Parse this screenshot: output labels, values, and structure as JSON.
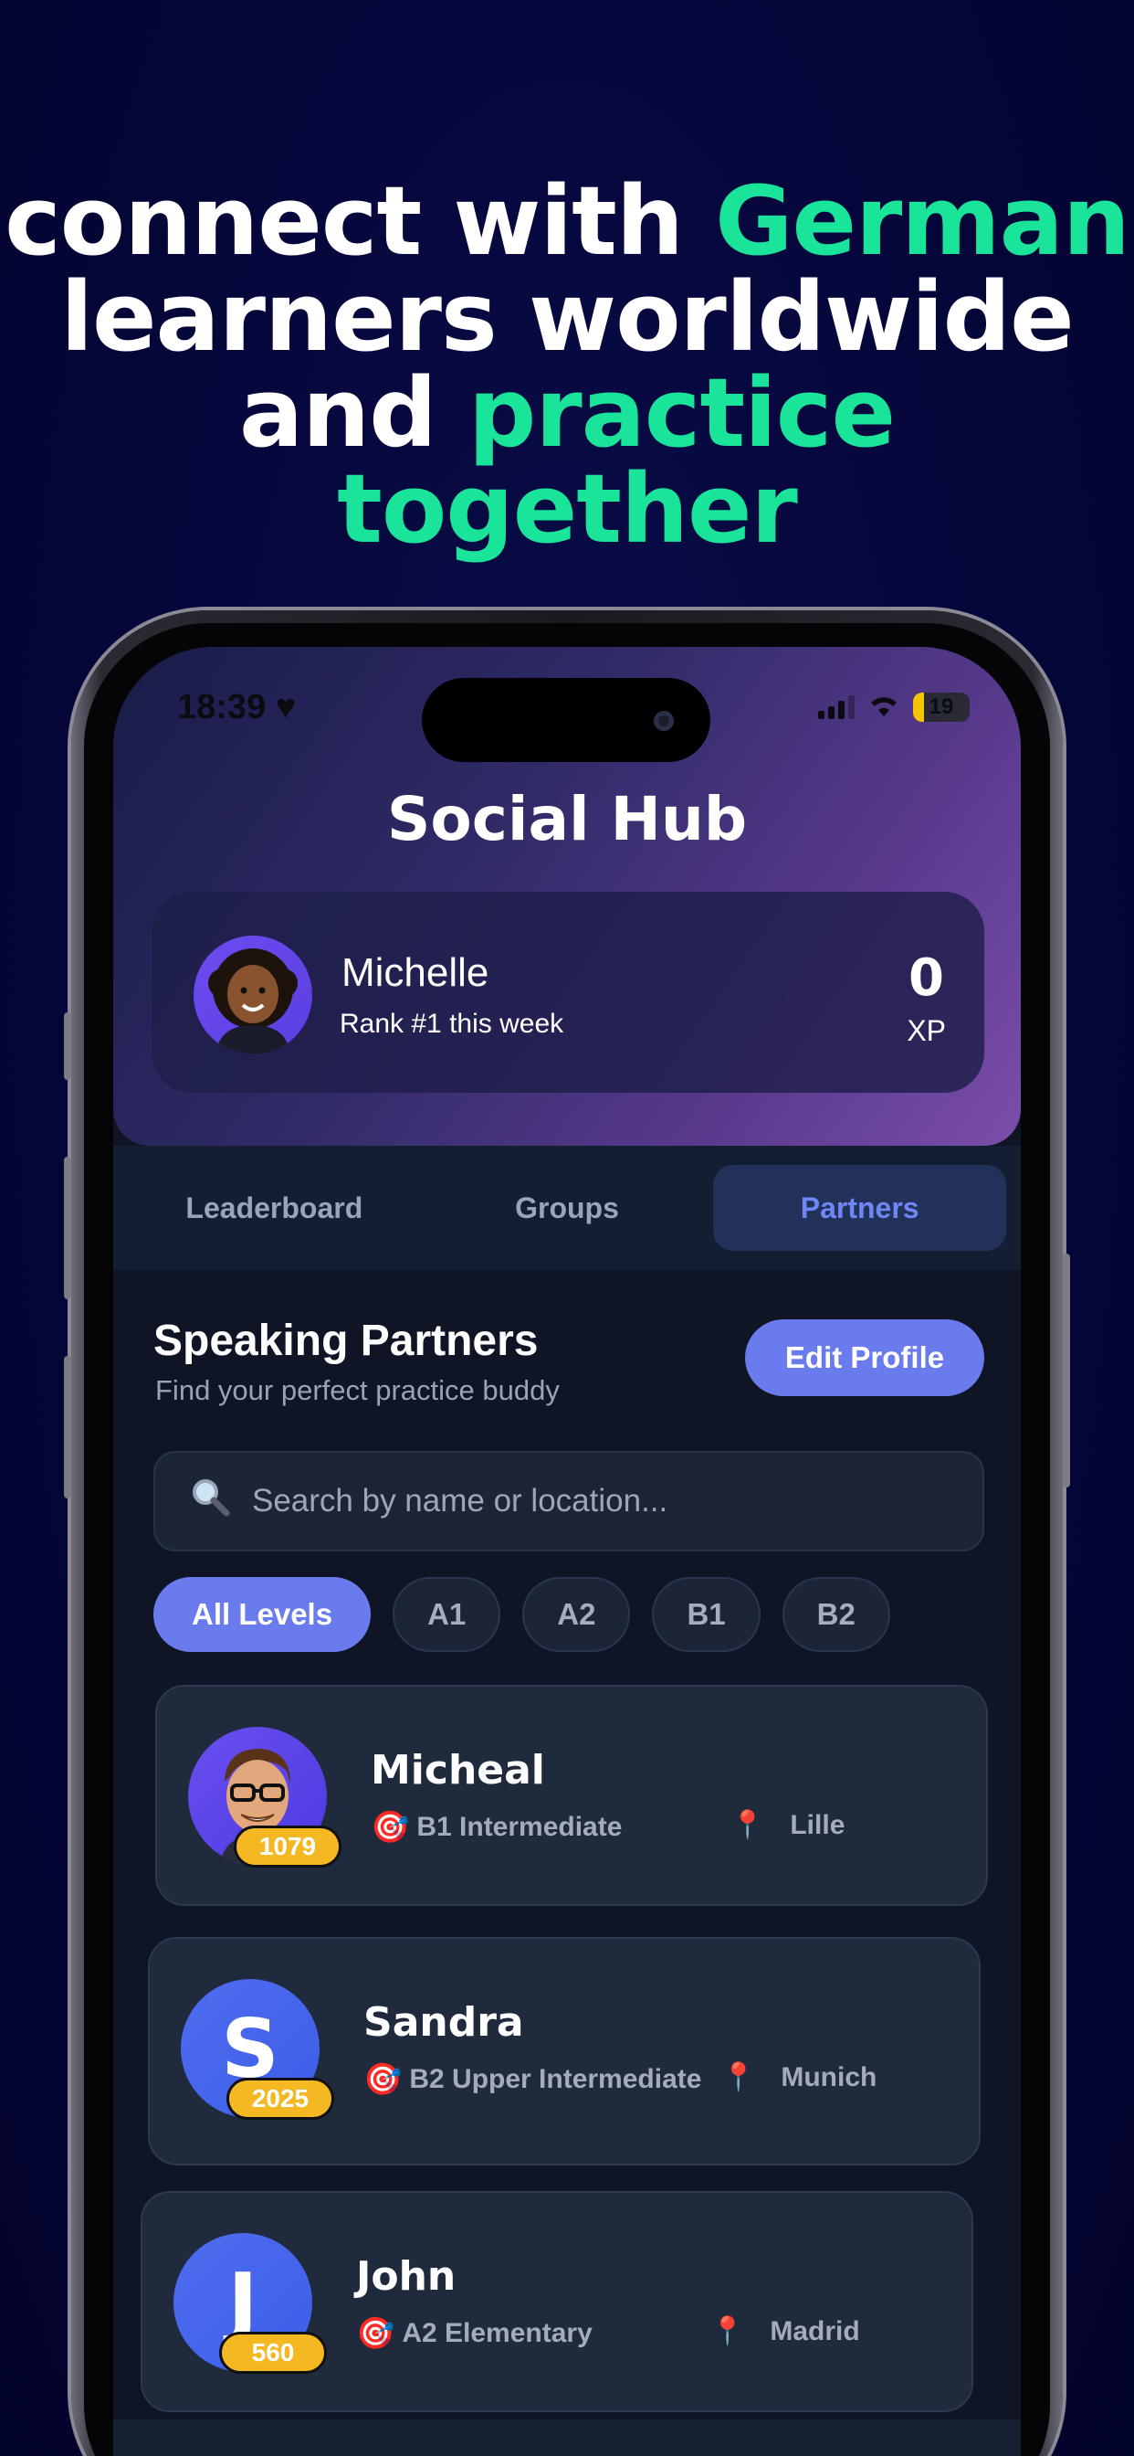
{
  "headline": {
    "line1_white": "connect with ",
    "line1_accent": "German",
    "line2": "learners worldwide",
    "line3_white": "and ",
    "line3_accent": "practice together"
  },
  "status_bar": {
    "time": "18:39 ♥",
    "battery": "19"
  },
  "screen_title": "Social Hub",
  "profile": {
    "name": "Michelle",
    "rank": "Rank #1 this week",
    "xp_value": "0",
    "xp_label": "XP"
  },
  "tabs": [
    {
      "label": "Leaderboard",
      "active": false
    },
    {
      "label": "Groups",
      "active": false
    },
    {
      "label": "Partners",
      "active": true
    }
  ],
  "section": {
    "title": "Speaking Partners",
    "subtitle": "Find your perfect practice buddy",
    "edit_button": "Edit Profile"
  },
  "search": {
    "placeholder": "Search by name or location..."
  },
  "filters": [
    "All Levels",
    "A1",
    "A2",
    "B1",
    "B2"
  ],
  "partners": [
    {
      "name": "Micheal",
      "score": "1079",
      "level": "B1 Intermediate",
      "location": "Lille",
      "avatar": "cartoon-man"
    },
    {
      "name": "Sandra",
      "score": "2025",
      "level": "B2 Upper Intermediate",
      "location": "Munich",
      "avatar_letter": "S"
    },
    {
      "name": "John",
      "score": "560",
      "level": "A2 Elementary",
      "location": "Madrid",
      "avatar_letter": "J"
    }
  ],
  "colors": {
    "accent_green": "#19e49a",
    "primary": "#6a7bee",
    "badge": "#f4b822",
    "background": "#05063a"
  }
}
